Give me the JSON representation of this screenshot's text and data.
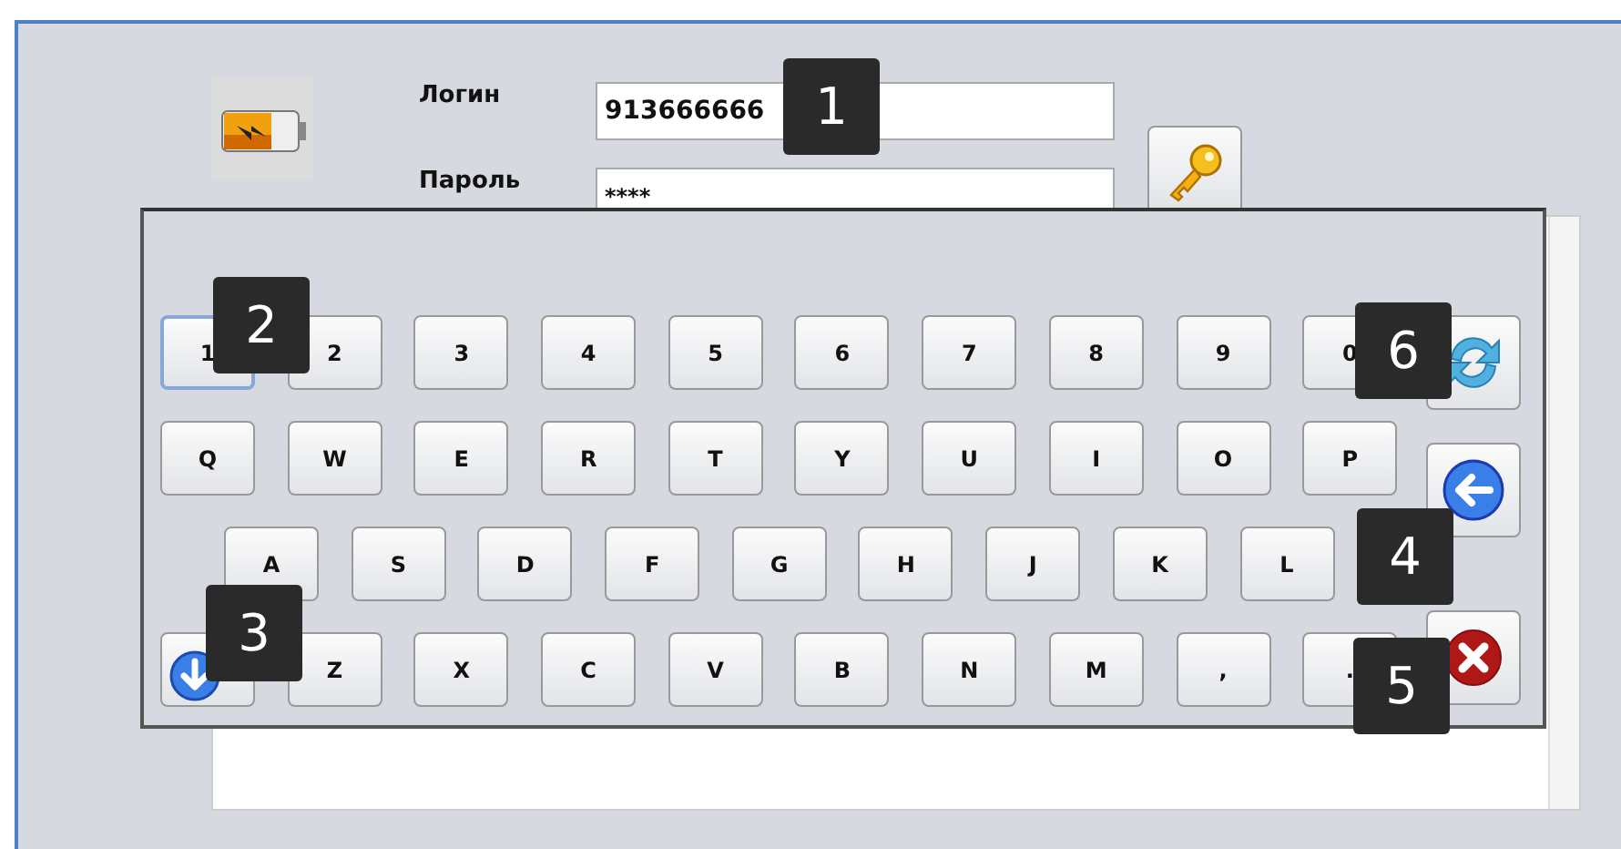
{
  "login": {
    "label": "Логин",
    "value": "913666666"
  },
  "password": {
    "label": "Пароль",
    "value": "****"
  },
  "keyboard": {
    "rows": [
      {
        "keys": [
          {
            "kind": "char",
            "label": "1",
            "focused": true
          },
          {
            "kind": "char",
            "label": "2",
            "focused": false
          },
          {
            "kind": "char",
            "label": "3",
            "focused": false
          },
          {
            "kind": "char",
            "label": "4",
            "focused": false
          },
          {
            "kind": "char",
            "label": "5",
            "focused": false
          },
          {
            "kind": "char",
            "label": "6",
            "focused": false
          },
          {
            "kind": "char",
            "label": "7",
            "focused": false
          },
          {
            "kind": "char",
            "label": "8",
            "focused": false
          },
          {
            "kind": "char",
            "label": "9",
            "focused": false
          },
          {
            "kind": "char",
            "label": "0",
            "focused": false
          }
        ]
      },
      {
        "keys": [
          {
            "kind": "char",
            "label": "Q",
            "focused": false
          },
          {
            "kind": "char",
            "label": "W",
            "focused": false
          },
          {
            "kind": "char",
            "label": "E",
            "focused": false
          },
          {
            "kind": "char",
            "label": "R",
            "focused": false
          },
          {
            "kind": "char",
            "label": "T",
            "focused": false
          },
          {
            "kind": "char",
            "label": "Y",
            "focused": false
          },
          {
            "kind": "char",
            "label": "U",
            "focused": false
          },
          {
            "kind": "char",
            "label": "I",
            "focused": false
          },
          {
            "kind": "char",
            "label": "O",
            "focused": false
          },
          {
            "kind": "char",
            "label": "P",
            "focused": false
          }
        ]
      },
      {
        "keys": [
          {
            "kind": "char",
            "label": "A",
            "focused": false
          },
          {
            "kind": "char",
            "label": "S",
            "focused": false
          },
          {
            "kind": "char",
            "label": "D",
            "focused": false
          },
          {
            "kind": "char",
            "label": "F",
            "focused": false
          },
          {
            "kind": "char",
            "label": "G",
            "focused": false
          },
          {
            "kind": "char",
            "label": "H",
            "focused": false
          },
          {
            "kind": "char",
            "label": "J",
            "focused": false
          },
          {
            "kind": "char",
            "label": "K",
            "focused": false
          },
          {
            "kind": "char",
            "label": "L",
            "focused": false
          }
        ]
      },
      {
        "keys": [
          {
            "kind": "down",
            "focused": false
          },
          {
            "kind": "char",
            "label": "Z",
            "focused": false
          },
          {
            "kind": "char",
            "label": "X",
            "focused": false
          },
          {
            "kind": "char",
            "label": "C",
            "focused": false
          },
          {
            "kind": "char",
            "label": "V",
            "focused": false
          },
          {
            "kind": "char",
            "label": "B",
            "focused": false
          },
          {
            "kind": "char",
            "label": "N",
            "focused": false
          },
          {
            "kind": "char",
            "label": "M",
            "focused": false
          },
          {
            "kind": "char",
            "label": ",",
            "focused": false
          },
          {
            "kind": "char",
            "label": ".",
            "focused": false
          }
        ]
      }
    ],
    "side_keys": [
      {
        "kind": "refresh"
      },
      {
        "kind": "backspace"
      },
      {
        "kind": "clear"
      }
    ]
  },
  "callouts": [
    {
      "label": "1"
    },
    {
      "label": "2"
    },
    {
      "label": "3"
    },
    {
      "label": "6"
    },
    {
      "label": "4"
    },
    {
      "label": "5"
    }
  ]
}
